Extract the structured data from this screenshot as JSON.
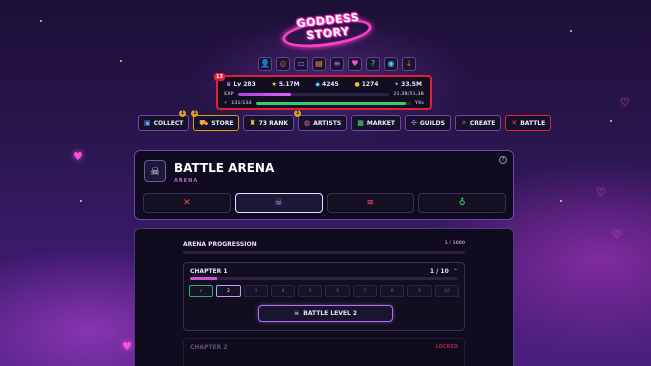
{
  "logo": {
    "line1": "GODDESS",
    "line2": "STORY"
  },
  "top_icons": [
    "user-icon",
    "target-icon",
    "chat-icon",
    "scroll-icon",
    "list-icon",
    "heart-icon",
    "question-icon",
    "discord-icon",
    "download-icon"
  ],
  "stats": {
    "notification_count": "13",
    "level": "Lv 283",
    "stars": "5.17M",
    "gems": "4245",
    "coins": "1274",
    "power": "33.5M",
    "exp_label": "EXP",
    "exp_value": "21.3B/51.3B",
    "exp_fraction": 0.35,
    "energy_value": "131/134",
    "energy_suffix": "Y8s",
    "energy_fraction": 0.97
  },
  "nav": [
    {
      "label": "COLLECT",
      "icon": "box-icon",
      "badge": "1"
    },
    {
      "label": "STORE",
      "icon": "cart-icon",
      "badge": "1"
    },
    {
      "label": "73 RANK",
      "icon": "trophy-icon",
      "badge": ""
    },
    {
      "label": "ARTISTS",
      "icon": "palette-icon",
      "badge": "1"
    },
    {
      "label": "MARKET",
      "icon": "market-icon",
      "badge": ""
    },
    {
      "label": "GUILDS",
      "icon": "guild-icon",
      "badge": ""
    },
    {
      "label": "CREATE",
      "icon": "wand-icon",
      "badge": ""
    },
    {
      "label": "BATTLE",
      "icon": "swords-icon",
      "badge": ""
    }
  ],
  "arena": {
    "title": "BATTLE ARENA",
    "subtitle": "ARENA",
    "help": "?"
  },
  "progression": {
    "title": "ARENA PROGRESSION",
    "count": "1 / 1000",
    "chapter1": {
      "title": "CHAPTER 1",
      "count": "1 / 10",
      "fraction": 0.1,
      "levels": [
        "✓",
        "2",
        "3",
        "4",
        "5",
        "6",
        "7",
        "8",
        "9",
        "10"
      ]
    },
    "battle_button": "BATTLE LEVEL 2",
    "chapter2": {
      "title": "CHAPTER 2",
      "status": "LOCKED"
    }
  },
  "colors": {
    "accent_pink": "#ff3ec8",
    "danger": "#e0203a",
    "success": "#2fb06a"
  }
}
